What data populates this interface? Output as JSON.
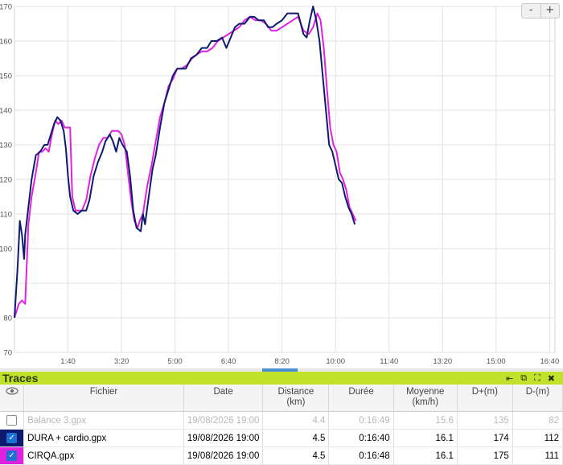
{
  "chart_data": {
    "type": "line",
    "xlim_sec": [
      0,
      1010
    ],
    "ylim": [
      70,
      170
    ],
    "x_ticks": [
      {
        "value": 100,
        "label": "1:40"
      },
      {
        "value": 200,
        "label": "3:20"
      },
      {
        "value": 300,
        "label": "5:00"
      },
      {
        "value": 400,
        "label": "6:40"
      },
      {
        "value": 500,
        "label": "8:20"
      },
      {
        "value": 600,
        "label": "10:00"
      },
      {
        "value": 700,
        "label": "11:40"
      },
      {
        "value": 800,
        "label": "13:20"
      },
      {
        "value": 900,
        "label": "15:00"
      },
      {
        "value": 1000,
        "label": "16:40"
      }
    ],
    "y_ticks": [
      70,
      80,
      90,
      100,
      110,
      120,
      130,
      140,
      150,
      160,
      170
    ],
    "y_tick_labels": [
      "70",
      "80",
      "100",
      "110",
      "120",
      "130",
      "140",
      "150",
      "160",
      "170"
    ],
    "grid": true,
    "series": [
      {
        "color": "#0d1a6e",
        "points": [
          [
            0,
            80
          ],
          [
            6,
            95
          ],
          [
            10,
            108
          ],
          [
            14,
            104
          ],
          [
            18,
            97
          ],
          [
            20,
            104
          ],
          [
            26,
            112
          ],
          [
            32,
            120
          ],
          [
            40,
            127
          ],
          [
            48,
            128
          ],
          [
            56,
            130
          ],
          [
            62,
            130
          ],
          [
            68,
            133
          ],
          [
            74,
            136
          ],
          [
            80,
            138
          ],
          [
            86,
            137
          ],
          [
            92,
            134
          ],
          [
            96,
            129
          ],
          [
            100,
            121
          ],
          [
            104,
            115
          ],
          [
            110,
            111
          ],
          [
            118,
            110
          ],
          [
            126,
            111
          ],
          [
            134,
            111
          ],
          [
            140,
            114
          ],
          [
            148,
            121
          ],
          [
            156,
            125
          ],
          [
            164,
            128
          ],
          [
            170,
            131
          ],
          [
            178,
            133
          ],
          [
            184,
            131
          ],
          [
            190,
            128
          ],
          [
            196,
            132
          ],
          [
            202,
            130
          ],
          [
            210,
            128
          ],
          [
            216,
            121
          ],
          [
            222,
            111
          ],
          [
            228,
            106
          ],
          [
            236,
            105
          ],
          [
            240,
            110
          ],
          [
            244,
            107
          ],
          [
            250,
            114
          ],
          [
            258,
            123
          ],
          [
            264,
            127
          ],
          [
            272,
            135
          ],
          [
            280,
            142
          ],
          [
            288,
            146
          ],
          [
            296,
            150
          ],
          [
            304,
            152
          ],
          [
            312,
            152
          ],
          [
            320,
            152
          ],
          [
            330,
            155
          ],
          [
            340,
            156
          ],
          [
            350,
            158
          ],
          [
            360,
            158
          ],
          [
            368,
            160
          ],
          [
            378,
            160
          ],
          [
            388,
            161
          ],
          [
            396,
            158
          ],
          [
            404,
            161
          ],
          [
            412,
            164
          ],
          [
            420,
            165
          ],
          [
            430,
            165
          ],
          [
            440,
            167
          ],
          [
            448,
            167
          ],
          [
            456,
            166
          ],
          [
            466,
            166
          ],
          [
            474,
            164
          ],
          [
            482,
            164
          ],
          [
            490,
            165
          ],
          [
            500,
            166
          ],
          [
            510,
            168
          ],
          [
            520,
            168
          ],
          [
            530,
            168
          ],
          [
            540,
            162
          ],
          [
            546,
            161
          ],
          [
            552,
            166
          ],
          [
            558,
            170
          ],
          [
            564,
            166
          ],
          [
            570,
            160
          ],
          [
            576,
            150
          ],
          [
            582,
            140
          ],
          [
            588,
            130
          ],
          [
            594,
            128
          ],
          [
            600,
            124
          ],
          [
            606,
            120
          ],
          [
            612,
            119
          ],
          [
            618,
            115
          ],
          [
            624,
            112
          ],
          [
            630,
            110
          ],
          [
            636,
            107
          ]
        ]
      },
      {
        "color": "#e022e0",
        "points": [
          [
            0,
            80
          ],
          [
            8,
            84
          ],
          [
            14,
            85
          ],
          [
            20,
            84
          ],
          [
            26,
            107
          ],
          [
            32,
            115
          ],
          [
            40,
            122
          ],
          [
            46,
            128
          ],
          [
            52,
            128
          ],
          [
            58,
            129
          ],
          [
            64,
            128
          ],
          [
            70,
            133
          ],
          [
            76,
            137
          ],
          [
            82,
            136
          ],
          [
            88,
            137
          ],
          [
            94,
            135
          ],
          [
            100,
            135
          ],
          [
            104,
            135
          ],
          [
            108,
            115
          ],
          [
            114,
            111
          ],
          [
            120,
            111
          ],
          [
            126,
            111
          ],
          [
            134,
            114
          ],
          [
            142,
            121
          ],
          [
            150,
            126
          ],
          [
            158,
            130
          ],
          [
            166,
            132
          ],
          [
            174,
            132
          ],
          [
            182,
            134
          ],
          [
            188,
            134
          ],
          [
            194,
            134
          ],
          [
            200,
            133
          ],
          [
            206,
            130
          ],
          [
            212,
            122
          ],
          [
            218,
            114
          ],
          [
            224,
            108
          ],
          [
            230,
            106
          ],
          [
            234,
            108
          ],
          [
            240,
            110
          ],
          [
            248,
            118
          ],
          [
            256,
            124
          ],
          [
            264,
            131
          ],
          [
            272,
            138
          ],
          [
            280,
            142
          ],
          [
            288,
            147
          ],
          [
            296,
            149
          ],
          [
            304,
            152
          ],
          [
            312,
            152
          ],
          [
            322,
            153
          ],
          [
            332,
            155
          ],
          [
            340,
            156
          ],
          [
            350,
            157
          ],
          [
            360,
            157
          ],
          [
            370,
            158
          ],
          [
            380,
            160
          ],
          [
            390,
            161
          ],
          [
            400,
            162
          ],
          [
            410,
            163
          ],
          [
            420,
            164
          ],
          [
            430,
            166
          ],
          [
            440,
            167
          ],
          [
            450,
            166
          ],
          [
            460,
            166
          ],
          [
            470,
            165
          ],
          [
            480,
            163
          ],
          [
            490,
            163
          ],
          [
            500,
            164
          ],
          [
            510,
            165
          ],
          [
            520,
            166
          ],
          [
            530,
            167
          ],
          [
            540,
            163
          ],
          [
            550,
            162
          ],
          [
            558,
            164
          ],
          [
            566,
            168
          ],
          [
            572,
            166
          ],
          [
            578,
            158
          ],
          [
            584,
            146
          ],
          [
            590,
            135
          ],
          [
            596,
            130
          ],
          [
            602,
            128
          ],
          [
            608,
            122
          ],
          [
            614,
            120
          ],
          [
            620,
            117
          ],
          [
            626,
            112
          ],
          [
            632,
            110
          ],
          [
            638,
            108
          ]
        ]
      }
    ]
  },
  "zoom": {
    "minus": "-",
    "plus": "+"
  },
  "panel": {
    "title": "Traces",
    "tools": [
      "⇤",
      "⧉",
      "⛶",
      "✖"
    ]
  },
  "table": {
    "headers": {
      "fichier": "Fichier",
      "date": "Date",
      "distance": "Distance",
      "distance_unit": "(km)",
      "duree": "Durée",
      "moyenne": "Moyenne",
      "moyenne_unit": "(km/h)",
      "dplus": "D+(m)",
      "dminus": "D-(m)"
    },
    "rows": [
      {
        "name": "Balance 3.gpx",
        "date": "19/08/2026 19:00",
        "distance": "4.4",
        "duree": "0:16:49",
        "moyenne": "15.6",
        "dplus": "135",
        "dminus": "82",
        "checked": false,
        "color": "#ffffff",
        "dim": true
      },
      {
        "name": "DURA + cardio.gpx",
        "date": "19/08/2026 19:00",
        "distance": "4.5",
        "duree": "0:16:40",
        "moyenne": "16.1",
        "dplus": "174",
        "dminus": "112",
        "checked": true,
        "color": "#0d1a6e",
        "dim": false
      },
      {
        "name": "CIRQA.gpx",
        "date": "19/08/2026 19:00",
        "distance": "4.5",
        "duree": "0:16:48",
        "moyenne": "16.1",
        "dplus": "175",
        "dminus": "111",
        "checked": true,
        "color": "#e022e0",
        "dim": false
      }
    ]
  }
}
